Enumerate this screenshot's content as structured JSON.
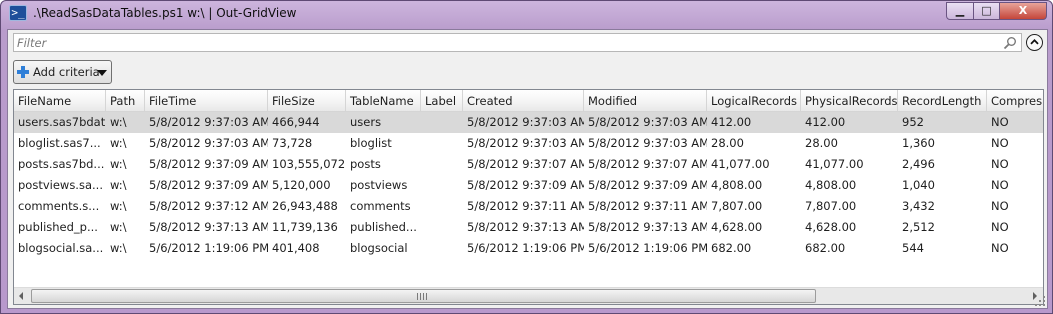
{
  "window": {
    "title": ".\\ReadSasDataTables.ps1 w:\\ | Out-GridView",
    "min_label": "▁",
    "max_label": "□",
    "close_label": "X"
  },
  "filter": {
    "placeholder": "Filter",
    "value": ""
  },
  "add_criteria": {
    "label": "Add criteria"
  },
  "icons": {
    "app": "powershell-icon",
    "search": "search-icon",
    "collapse": "chevron-up-icon",
    "add": "plus-icon",
    "dropdown": "caret-down-icon"
  },
  "colors": {
    "titlebar": "#b899cc",
    "selected_row": "#d9d9d9",
    "plus_icon": "#2f7fd8"
  },
  "table": {
    "columns": [
      "FileName",
      "Path",
      "FileTime",
      "FileSize",
      "TableName",
      "Label",
      "Created",
      "Modified",
      "LogicalRecords",
      "PhysicalRecords",
      "RecordLength",
      "Compres"
    ],
    "rows": [
      [
        "users.sas7bdat",
        "w:\\",
        "5/8/2012 9:37:03 AM",
        "466,944",
        "users",
        "",
        "5/8/2012 9:37:03 AM",
        "5/8/2012 9:37:03 AM",
        "412.00",
        "412.00",
        "952",
        "NO"
      ],
      [
        "bloglist.sas7...",
        "w:\\",
        "5/8/2012 9:37:03 AM",
        "73,728",
        "bloglist",
        "",
        "5/8/2012 9:37:03 AM",
        "5/8/2012 9:37:03 AM",
        "28.00",
        "28.00",
        "1,360",
        "NO"
      ],
      [
        "posts.sas7bd...",
        "w:\\",
        "5/8/2012 9:37:09 AM",
        "103,555,072",
        "posts",
        "",
        "5/8/2012 9:37:07 AM",
        "5/8/2012 9:37:07 AM",
        "41,077.00",
        "41,077.00",
        "2,496",
        "NO"
      ],
      [
        "postviews.sa...",
        "w:\\",
        "5/8/2012 9:37:09 AM",
        "5,120,000",
        "postviews",
        "",
        "5/8/2012 9:37:09 AM",
        "5/8/2012 9:37:09 AM",
        "4,808.00",
        "4,808.00",
        "1,040",
        "NO"
      ],
      [
        "comments.s...",
        "w:\\",
        "5/8/2012 9:37:12 AM",
        "26,943,488",
        "comments",
        "",
        "5/8/2012 9:37:11 AM",
        "5/8/2012 9:37:11 AM",
        "7,807.00",
        "7,807.00",
        "3,432",
        "NO"
      ],
      [
        "published_p...",
        "w:\\",
        "5/8/2012 9:37:13 AM",
        "11,739,136",
        "published...",
        "",
        "5/8/2012 9:37:13 AM",
        "5/8/2012 9:37:13 AM",
        "4,628.00",
        "4,628.00",
        "2,512",
        "NO"
      ],
      [
        "blogsocial.sa...",
        "w:\\",
        "5/6/2012 1:19:06 PM",
        "401,408",
        "blogsocial",
        "",
        "5/6/2012 1:19:06 PM",
        "5/6/2012 1:19:06 PM",
        "682.00",
        "682.00",
        "544",
        "NO"
      ]
    ],
    "selected_row": 0
  }
}
